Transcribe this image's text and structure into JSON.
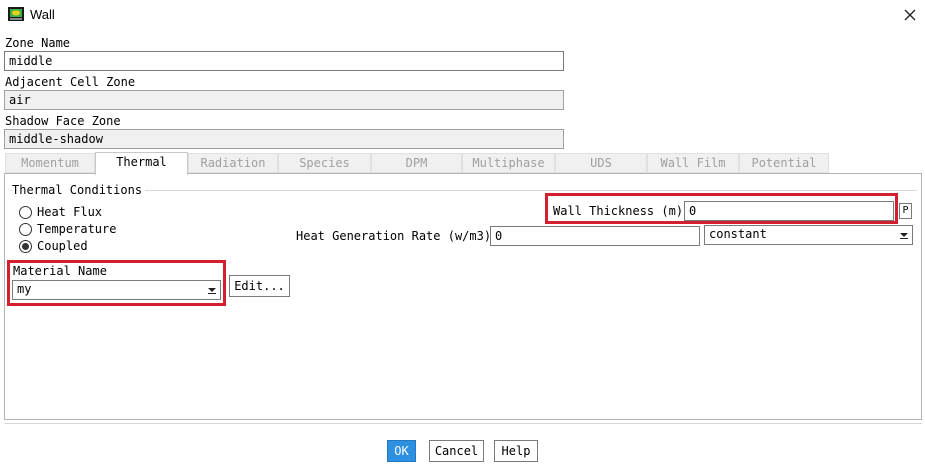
{
  "window": {
    "title": "Wall",
    "close_icon": "close-icon",
    "app_icon": "fluent-window-icon"
  },
  "fields": {
    "zone_name": {
      "label": "Zone Name",
      "value": "middle"
    },
    "adjacent_cell_zone": {
      "label": "Adjacent Cell Zone",
      "value": "air"
    },
    "shadow_face_zone": {
      "label": "Shadow Face Zone",
      "value": "middle-shadow"
    }
  },
  "tabs": [
    {
      "label": "Momentum",
      "active": false
    },
    {
      "label": "Thermal",
      "active": true
    },
    {
      "label": "Radiation",
      "active": false
    },
    {
      "label": "Species",
      "active": false
    },
    {
      "label": "DPM",
      "active": false
    },
    {
      "label": "Multiphase",
      "active": false
    },
    {
      "label": "UDS",
      "active": false
    },
    {
      "label": "Wall Film",
      "active": false
    },
    {
      "label": "Potential",
      "active": false
    }
  ],
  "thermal": {
    "group_label": "Thermal Conditions",
    "options": [
      {
        "label": "Heat Flux",
        "selected": false
      },
      {
        "label": "Temperature",
        "selected": false
      },
      {
        "label": "Coupled",
        "selected": true
      }
    ],
    "material": {
      "label": "Material Name",
      "value": "my",
      "edit_label": "Edit..."
    },
    "wall_thickness": {
      "label": "Wall Thickness (m)",
      "value": "0",
      "param_label": "P"
    },
    "heat_generation": {
      "label": "Heat Generation Rate (w/m3)",
      "value": "0",
      "method": "constant"
    }
  },
  "buttons": {
    "ok": "OK",
    "cancel": "Cancel",
    "help": "Help"
  },
  "colors": {
    "highlight": "#d4202e",
    "primary_button": "#2e90e0"
  }
}
